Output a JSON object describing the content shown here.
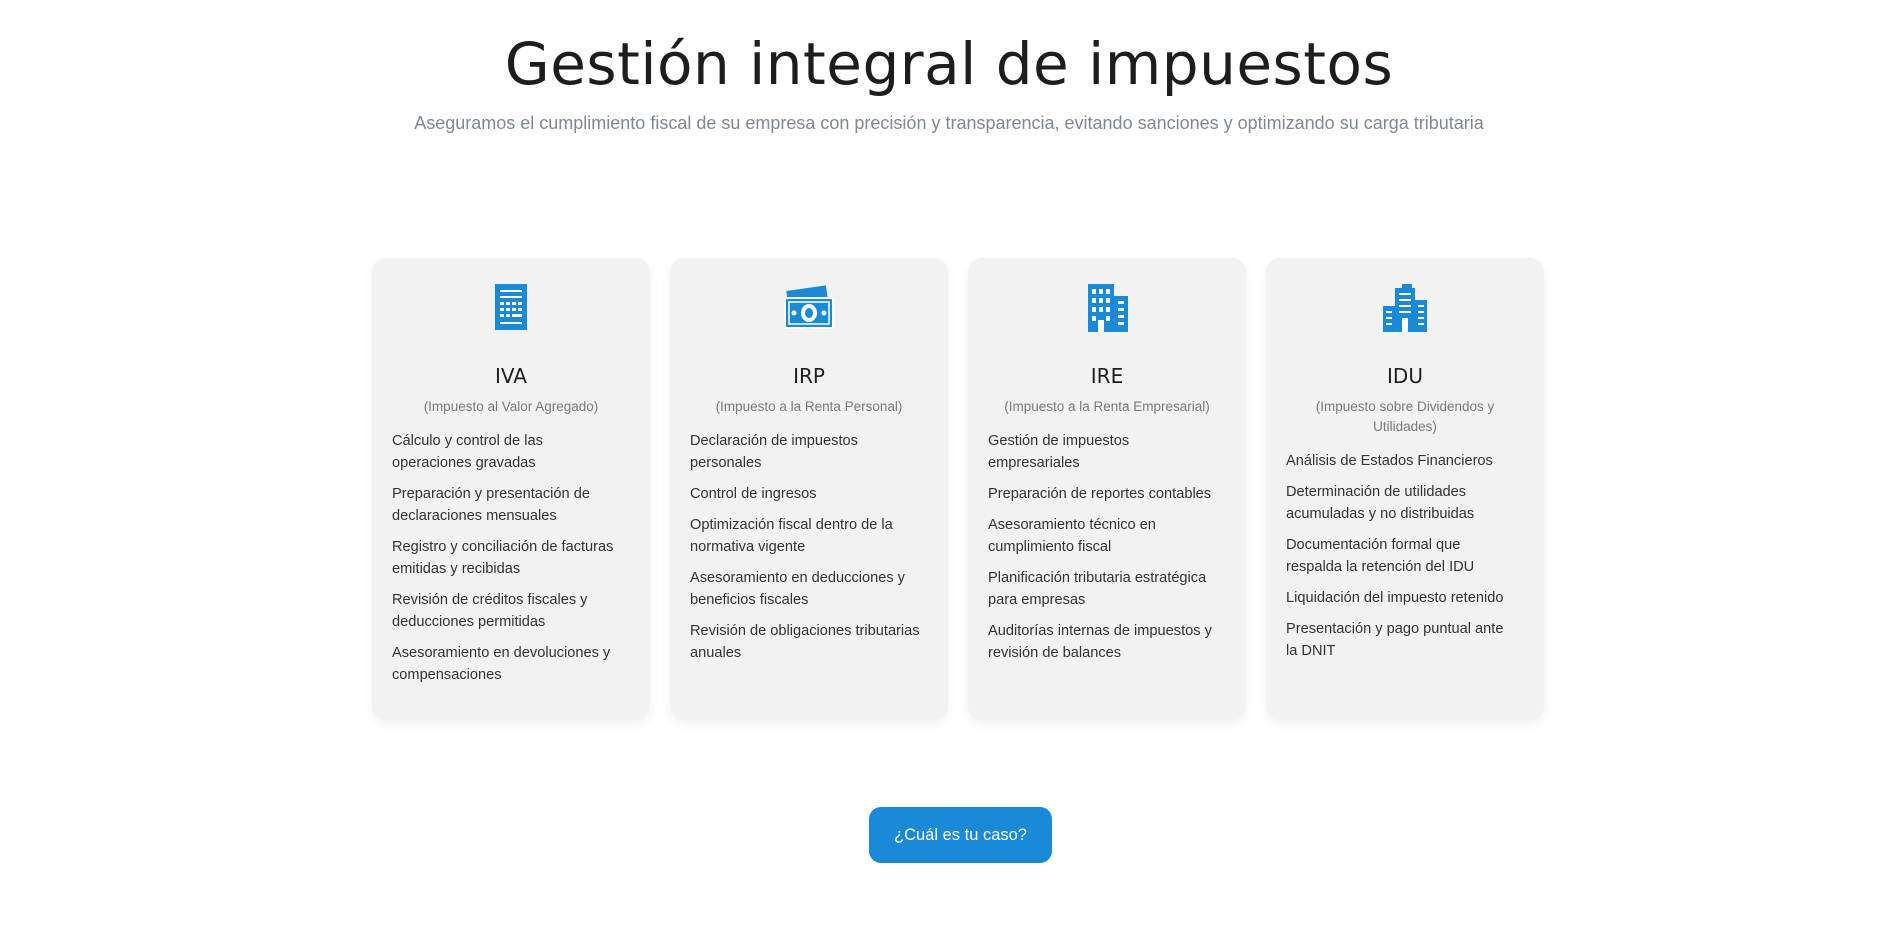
{
  "header": {
    "title": "Gestión integral de impuestos",
    "subtitle": "Aseguramos el cumplimiento fiscal de su empresa con precisión y transparencia, evitando sanciones y optimizando su carga tributaria"
  },
  "theme": {
    "accent": "#1a8ad8",
    "card_bg": "#f2f2f2"
  },
  "cards": [
    {
      "icon": "calculator-icon",
      "title": "IVA",
      "subtitle": "(Impuesto al Valor Agregado)",
      "items": [
        "Cálculo y control de las operaciones gravadas",
        "Preparación y presentación de declaraciones mensuales",
        "Registro y conciliación de facturas emitidas y recibidas",
        "Revisión de créditos fiscales y deducciones permitidas",
        "Asesoramiento en devoluciones y compensaciones"
      ]
    },
    {
      "icon": "money-bills-icon",
      "title": "IRP",
      "subtitle": "(Impuesto a la Renta Personal)",
      "items": [
        "Declaración de impuestos personales",
        "Control de ingresos",
        "Optimización fiscal dentro de la normativa vigente",
        "Asesoramiento en deducciones y beneficios fiscales",
        "Revisión de obligaciones tributarias anuales"
      ]
    },
    {
      "icon": "office-building-icon",
      "title": "IRE",
      "subtitle": "(Impuesto a la Renta Empresarial)",
      "items": [
        "Gestión de impuestos empresariales",
        "Preparación de reportes contables",
        "Asesoramiento técnico en cumplimiento fiscal",
        "Planificación tributaria estratégica para empresas",
        "Auditorías internas de impuestos y revisión de balances"
      ]
    },
    {
      "icon": "city-buildings-icon",
      "title": "IDU",
      "subtitle": "(Impuesto sobre Dividendos y Utilidades)",
      "items": [
        "Análisis de Estados Financieros",
        "Determinación de utilidades acumuladas y no distribuidas",
        "Documentación formal que respalda la retención del IDU",
        "Liquidación del impuesto retenido",
        "Presentación y pago puntual ante la DNIT"
      ]
    }
  ],
  "cta": {
    "label": "¿Cuál es tu caso?"
  }
}
